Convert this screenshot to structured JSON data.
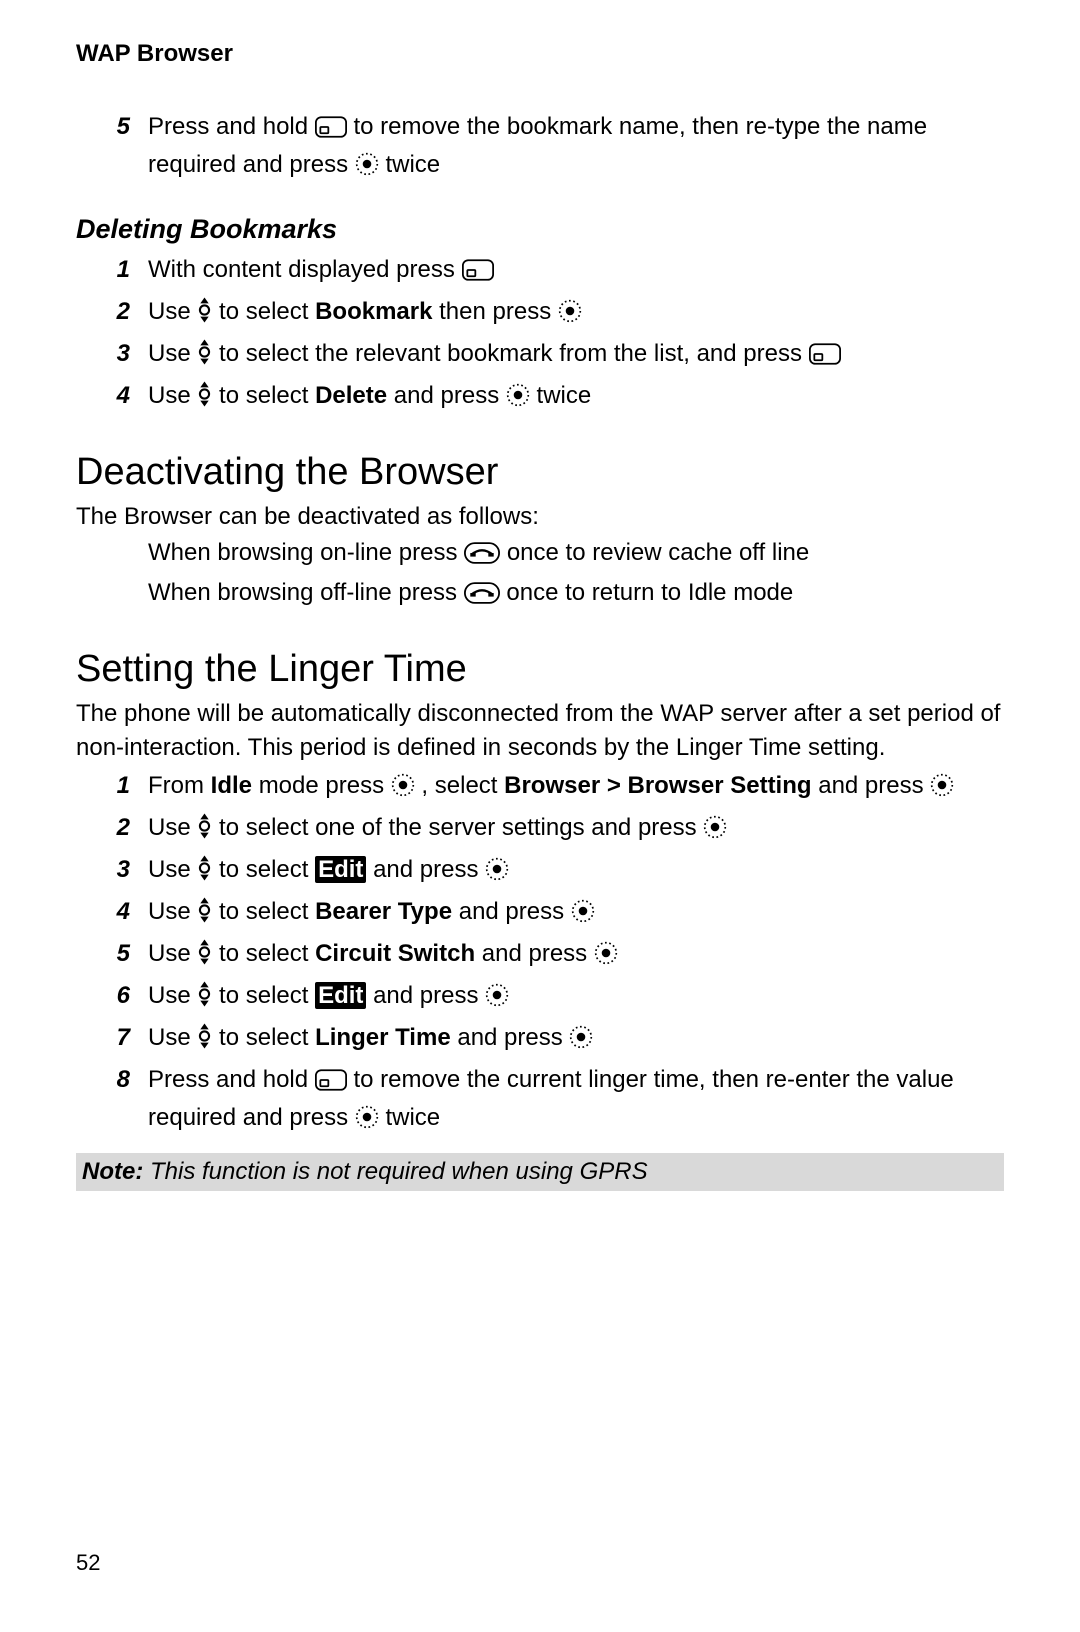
{
  "header": "WAP Browser",
  "pageNumber": "52",
  "top_step": {
    "num": "5",
    "a": "Press and hold ",
    "b": " to remove the bookmark name, then re-type the name required and press ",
    "c": " twice"
  },
  "deleting": {
    "title": "Deleting Bookmarks",
    "steps": [
      {
        "num": "1",
        "a": "With content displayed press "
      },
      {
        "num": "2",
        "a": "Use ",
        "b": " to select ",
        "bold": "Bookmark",
        "c": " then press "
      },
      {
        "num": "3",
        "a": "Use ",
        "b": " to select the relevant bookmark from the list, and press "
      },
      {
        "num": "4",
        "a": "Use ",
        "b": " to select ",
        "bold": "Delete",
        "c": " and press ",
        "d": " twice"
      }
    ]
  },
  "deactivating": {
    "title": "Deactivating the Browser",
    "intro": "The Browser can be deactivated as follows:",
    "line1a": "When browsing on-line press ",
    "line1b": " once to review cache off line",
    "line2a": "When browsing off-line press ",
    "line2b": " once to return to ",
    "line2bold": "Idle",
    "line2c": " mode"
  },
  "linger": {
    "title": "Setting the Linger Time",
    "intro_a": "The phone will be automatically disconnected from the WAP server after a set period of non-interaction. This period is defined in seconds by the ",
    "intro_bold": "Linger Time",
    "intro_b": " setting.",
    "steps": [
      {
        "num": "1",
        "a": "From ",
        "bold1": "Idle",
        "b": " mode press ",
        "c": ", select ",
        "bold2": "Browser > Browser Setting",
        "d": " and press "
      },
      {
        "num": "2",
        "a": "Use ",
        "b": " to select one of the server settings and press "
      },
      {
        "num": "3",
        "a": "Use ",
        "b": " to select ",
        "edit": "Edit",
        "c": " and press "
      },
      {
        "num": "4",
        "a": "Use ",
        "b": " to select ",
        "bold": "Bearer Type",
        "c": " and press "
      },
      {
        "num": "5",
        "a": "Use ",
        "b": " to select ",
        "bold": "Circuit Switch",
        "c": " and press "
      },
      {
        "num": "6",
        "a": "Use ",
        "b": " to select ",
        "edit": "Edit",
        "c": " and press "
      },
      {
        "num": "7",
        "a": "Use ",
        "b": " to select ",
        "bold": "Linger Time",
        "c": " and press "
      },
      {
        "num": "8",
        "a": "Press and hold ",
        "b": " to remove the current linger time, then re-enter the value required and press ",
        "c": " twice"
      }
    ]
  },
  "note": {
    "label": "Note:",
    "text": " This function is not required when using GPRS"
  }
}
